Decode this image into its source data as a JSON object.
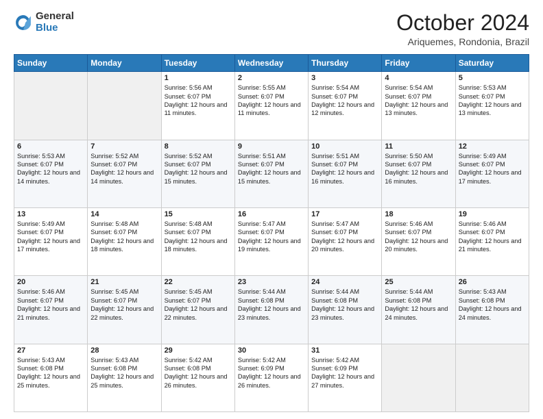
{
  "header": {
    "logo": {
      "general": "General",
      "blue": "Blue"
    },
    "title": "October 2024",
    "location": "Ariquemes, Rondonia, Brazil"
  },
  "days_of_week": [
    "Sunday",
    "Monday",
    "Tuesday",
    "Wednesday",
    "Thursday",
    "Friday",
    "Saturday"
  ],
  "weeks": [
    [
      {
        "day": "",
        "sunrise": "",
        "sunset": "",
        "daylight": ""
      },
      {
        "day": "",
        "sunrise": "",
        "sunset": "",
        "daylight": ""
      },
      {
        "day": "1",
        "sunrise": "Sunrise: 5:56 AM",
        "sunset": "Sunset: 6:07 PM",
        "daylight": "Daylight: 12 hours and 11 minutes."
      },
      {
        "day": "2",
        "sunrise": "Sunrise: 5:55 AM",
        "sunset": "Sunset: 6:07 PM",
        "daylight": "Daylight: 12 hours and 11 minutes."
      },
      {
        "day": "3",
        "sunrise": "Sunrise: 5:54 AM",
        "sunset": "Sunset: 6:07 PM",
        "daylight": "Daylight: 12 hours and 12 minutes."
      },
      {
        "day": "4",
        "sunrise": "Sunrise: 5:54 AM",
        "sunset": "Sunset: 6:07 PM",
        "daylight": "Daylight: 12 hours and 13 minutes."
      },
      {
        "day": "5",
        "sunrise": "Sunrise: 5:53 AM",
        "sunset": "Sunset: 6:07 PM",
        "daylight": "Daylight: 12 hours and 13 minutes."
      }
    ],
    [
      {
        "day": "6",
        "sunrise": "Sunrise: 5:53 AM",
        "sunset": "Sunset: 6:07 PM",
        "daylight": "Daylight: 12 hours and 14 minutes."
      },
      {
        "day": "7",
        "sunrise": "Sunrise: 5:52 AM",
        "sunset": "Sunset: 6:07 PM",
        "daylight": "Daylight: 12 hours and 14 minutes."
      },
      {
        "day": "8",
        "sunrise": "Sunrise: 5:52 AM",
        "sunset": "Sunset: 6:07 PM",
        "daylight": "Daylight: 12 hours and 15 minutes."
      },
      {
        "day": "9",
        "sunrise": "Sunrise: 5:51 AM",
        "sunset": "Sunset: 6:07 PM",
        "daylight": "Daylight: 12 hours and 15 minutes."
      },
      {
        "day": "10",
        "sunrise": "Sunrise: 5:51 AM",
        "sunset": "Sunset: 6:07 PM",
        "daylight": "Daylight: 12 hours and 16 minutes."
      },
      {
        "day": "11",
        "sunrise": "Sunrise: 5:50 AM",
        "sunset": "Sunset: 6:07 PM",
        "daylight": "Daylight: 12 hours and 16 minutes."
      },
      {
        "day": "12",
        "sunrise": "Sunrise: 5:49 AM",
        "sunset": "Sunset: 6:07 PM",
        "daylight": "Daylight: 12 hours and 17 minutes."
      }
    ],
    [
      {
        "day": "13",
        "sunrise": "Sunrise: 5:49 AM",
        "sunset": "Sunset: 6:07 PM",
        "daylight": "Daylight: 12 hours and 17 minutes."
      },
      {
        "day": "14",
        "sunrise": "Sunrise: 5:48 AM",
        "sunset": "Sunset: 6:07 PM",
        "daylight": "Daylight: 12 hours and 18 minutes."
      },
      {
        "day": "15",
        "sunrise": "Sunrise: 5:48 AM",
        "sunset": "Sunset: 6:07 PM",
        "daylight": "Daylight: 12 hours and 18 minutes."
      },
      {
        "day": "16",
        "sunrise": "Sunrise: 5:47 AM",
        "sunset": "Sunset: 6:07 PM",
        "daylight": "Daylight: 12 hours and 19 minutes."
      },
      {
        "day": "17",
        "sunrise": "Sunrise: 5:47 AM",
        "sunset": "Sunset: 6:07 PM",
        "daylight": "Daylight: 12 hours and 20 minutes."
      },
      {
        "day": "18",
        "sunrise": "Sunrise: 5:46 AM",
        "sunset": "Sunset: 6:07 PM",
        "daylight": "Daylight: 12 hours and 20 minutes."
      },
      {
        "day": "19",
        "sunrise": "Sunrise: 5:46 AM",
        "sunset": "Sunset: 6:07 PM",
        "daylight": "Daylight: 12 hours and 21 minutes."
      }
    ],
    [
      {
        "day": "20",
        "sunrise": "Sunrise: 5:46 AM",
        "sunset": "Sunset: 6:07 PM",
        "daylight": "Daylight: 12 hours and 21 minutes."
      },
      {
        "day": "21",
        "sunrise": "Sunrise: 5:45 AM",
        "sunset": "Sunset: 6:07 PM",
        "daylight": "Daylight: 12 hours and 22 minutes."
      },
      {
        "day": "22",
        "sunrise": "Sunrise: 5:45 AM",
        "sunset": "Sunset: 6:07 PM",
        "daylight": "Daylight: 12 hours and 22 minutes."
      },
      {
        "day": "23",
        "sunrise": "Sunrise: 5:44 AM",
        "sunset": "Sunset: 6:08 PM",
        "daylight": "Daylight: 12 hours and 23 minutes."
      },
      {
        "day": "24",
        "sunrise": "Sunrise: 5:44 AM",
        "sunset": "Sunset: 6:08 PM",
        "daylight": "Daylight: 12 hours and 23 minutes."
      },
      {
        "day": "25",
        "sunrise": "Sunrise: 5:44 AM",
        "sunset": "Sunset: 6:08 PM",
        "daylight": "Daylight: 12 hours and 24 minutes."
      },
      {
        "day": "26",
        "sunrise": "Sunrise: 5:43 AM",
        "sunset": "Sunset: 6:08 PM",
        "daylight": "Daylight: 12 hours and 24 minutes."
      }
    ],
    [
      {
        "day": "27",
        "sunrise": "Sunrise: 5:43 AM",
        "sunset": "Sunset: 6:08 PM",
        "daylight": "Daylight: 12 hours and 25 minutes."
      },
      {
        "day": "28",
        "sunrise": "Sunrise: 5:43 AM",
        "sunset": "Sunset: 6:08 PM",
        "daylight": "Daylight: 12 hours and 25 minutes."
      },
      {
        "day": "29",
        "sunrise": "Sunrise: 5:42 AM",
        "sunset": "Sunset: 6:08 PM",
        "daylight": "Daylight: 12 hours and 26 minutes."
      },
      {
        "day": "30",
        "sunrise": "Sunrise: 5:42 AM",
        "sunset": "Sunset: 6:09 PM",
        "daylight": "Daylight: 12 hours and 26 minutes."
      },
      {
        "day": "31",
        "sunrise": "Sunrise: 5:42 AM",
        "sunset": "Sunset: 6:09 PM",
        "daylight": "Daylight: 12 hours and 27 minutes."
      },
      {
        "day": "",
        "sunrise": "",
        "sunset": "",
        "daylight": ""
      },
      {
        "day": "",
        "sunrise": "",
        "sunset": "",
        "daylight": ""
      }
    ]
  ]
}
